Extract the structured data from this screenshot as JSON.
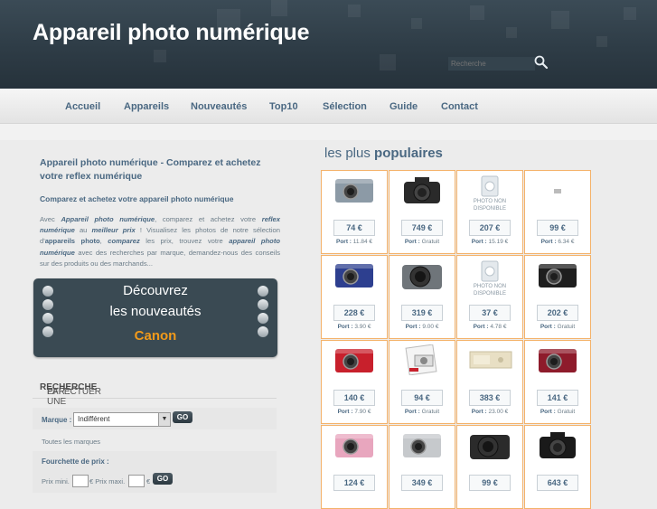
{
  "header": {
    "title": "Appareil photo numérique",
    "search_placeholder": "Recherche"
  },
  "nav": {
    "items": [
      "Accueil",
      "Appareils",
      "Nouveautés",
      "Top10",
      "Sélection",
      "Guide",
      "Contact"
    ]
  },
  "intro": {
    "title": "Appareil photo numérique - Comparez et achetez votre reflex numérique",
    "subtitle": "Comparez et achetez votre appareil photo numérique",
    "body_parts": [
      "Avec ",
      "Appareil photo numérique",
      ", comparez et achetez votre ",
      "reflex numérique",
      " au ",
      "meilleur prix",
      " ! Visualisez les photos de notre sélection d'",
      "appareils photo",
      ", ",
      "comparez",
      " les prix, trouvez votre ",
      "appareil photo numérique",
      " avec des recherches par marque, demandez-nous des conseils sur des produits ou des marchands..."
    ]
  },
  "promo": {
    "line1": "Découvrez",
    "line2": "les nouveautés",
    "brand": "Canon"
  },
  "search_panel": {
    "title_pre": "EFFECTUER UNE ",
    "title_bold": "RECHERCHE",
    "title_post": " PAR :",
    "marque_label": "Marque :",
    "marque_value": "Indifférent",
    "go_label": "GO",
    "all_brands": "Toutes les marques",
    "price_range_label": "Fourchette de prix :",
    "prix_min": "Prix mini.",
    "prix_max": "€ Prix maxi.",
    "euro": "€"
  },
  "popular": {
    "title_light": "les plus ",
    "title_bold": "populaires",
    "port_label": "Port :",
    "no_photo": "PHOTO NON DISPONIBLE",
    "products": [
      {
        "price": "74 €",
        "port": "11.84 €",
        "img": "silver-compact-camera",
        "color": "#8c9aa6"
      },
      {
        "price": "749 €",
        "port": "Gratuit",
        "img": "dslr-kit-camera",
        "color": "#2a2a2a"
      },
      {
        "price": "207 €",
        "port": "15.19 €",
        "img": "no-photo-camera",
        "color": "#cfd6dc"
      },
      {
        "price": "99 €",
        "port": "6.34 €",
        "img": "tiny-camera",
        "color": "#bbbbbb"
      },
      {
        "price": "228 €",
        "port": "3.90 €",
        "img": "blue-compact-camera",
        "color": "#2d3f8f"
      },
      {
        "price": "319 €",
        "port": "9.00 €",
        "img": "bridge-silver-camera",
        "color": "#6f757a"
      },
      {
        "price": "37 €",
        "port": "4.78 €",
        "img": "no-photo-camera",
        "color": "#cfd6dc"
      },
      {
        "price": "202 €",
        "port": "Gratuit",
        "img": "black-compact-camera",
        "color": "#1e1e1e"
      },
      {
        "price": "140 €",
        "port": "7.90 €",
        "img": "red-compact-camera",
        "color": "#c8202c"
      },
      {
        "price": "94 €",
        "port": "Gratuit",
        "img": "boxed-camera",
        "color": "#e6e6e6"
      },
      {
        "price": "383 €",
        "port": "23.00 €",
        "img": "cream-camera",
        "color": "#e8dfc4"
      },
      {
        "price": "141 €",
        "port": "Gratuit",
        "img": "burgundy-compact-camera",
        "color": "#8e1b2b"
      },
      {
        "price": "124 €",
        "port": "",
        "img": "pink-compact-camera",
        "color": "#e8a6be"
      },
      {
        "price": "349 €",
        "port": "",
        "img": "silver-mirrorless-camera",
        "color": "#c6c9cc"
      },
      {
        "price": "99 €",
        "port": "",
        "img": "black-bridge-camera",
        "color": "#2b2b2b"
      },
      {
        "price": "643 €",
        "port": "",
        "img": "black-dslr-camera",
        "color": "#1a1a1a"
      }
    ]
  }
}
